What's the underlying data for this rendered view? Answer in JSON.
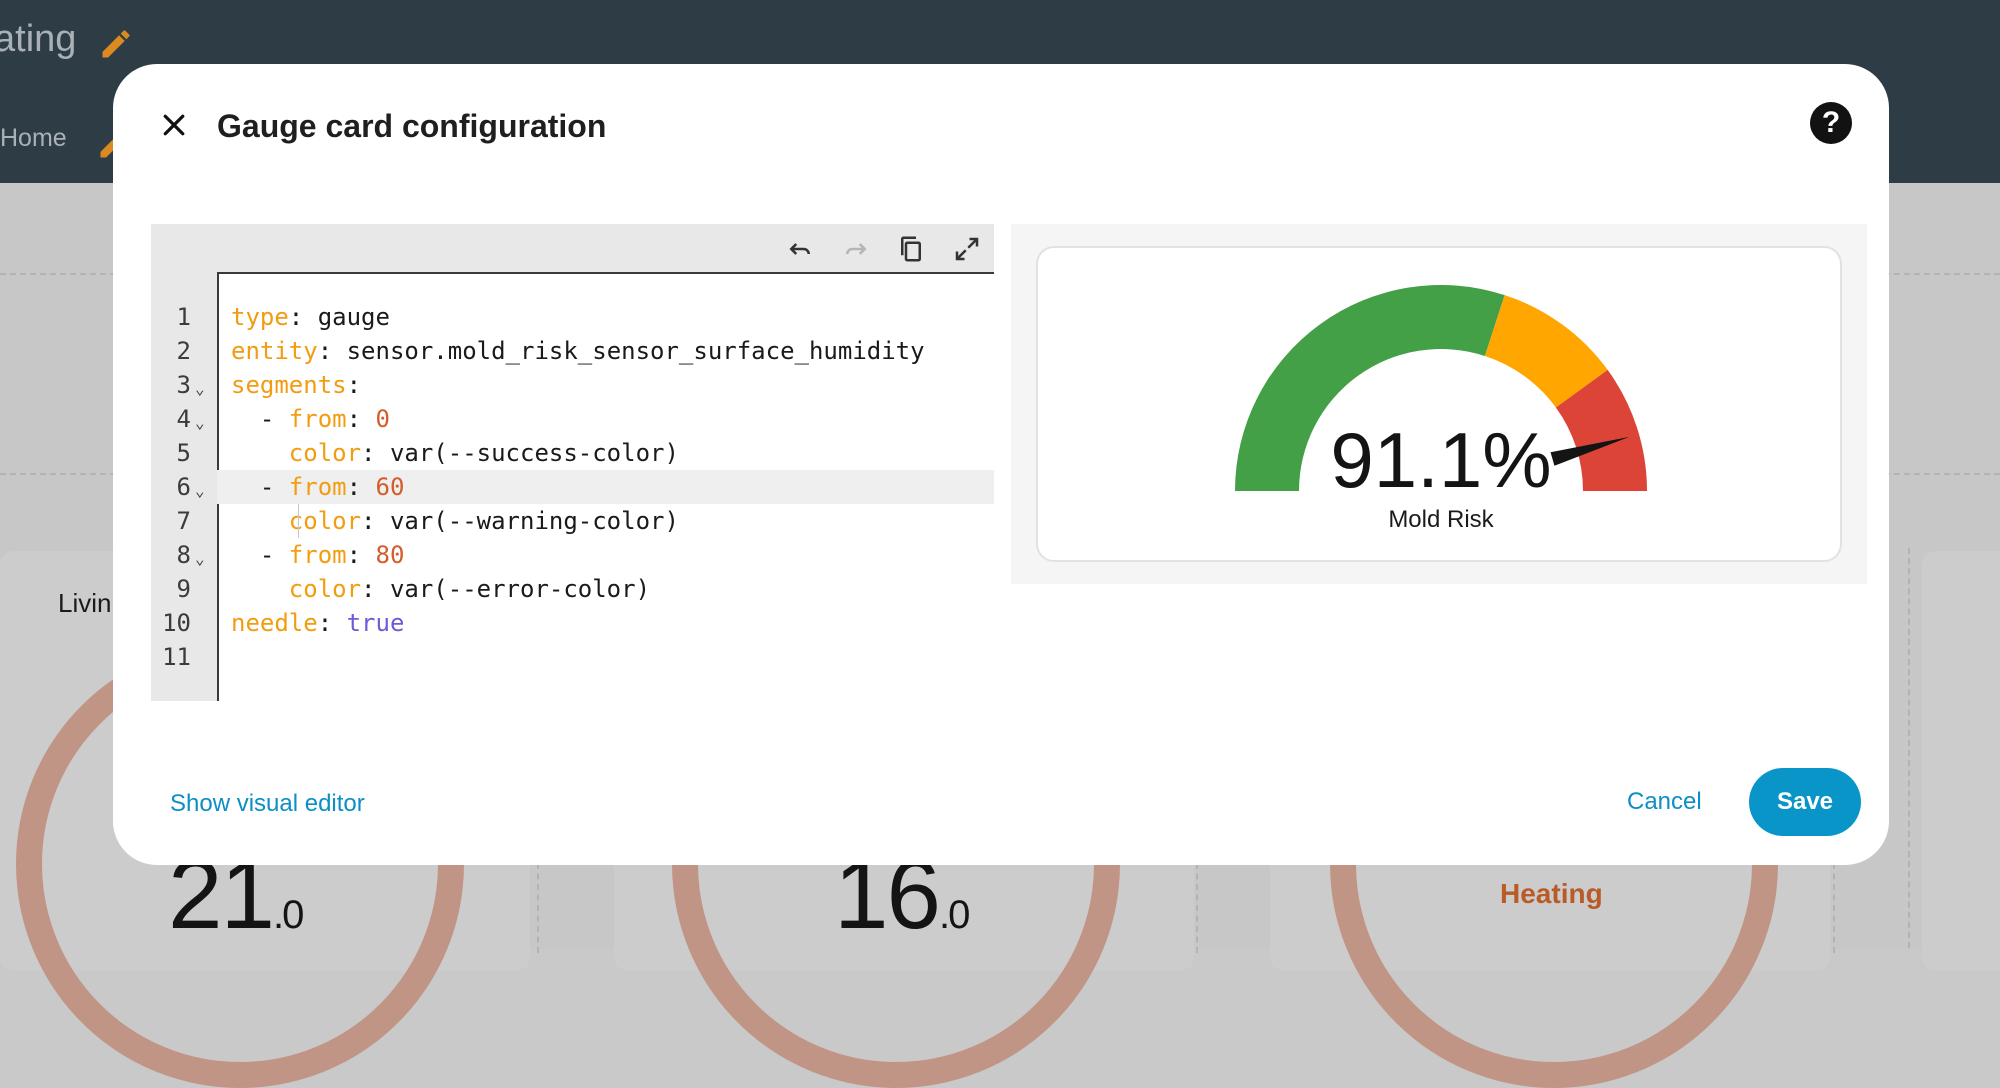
{
  "background": {
    "title": "ating",
    "tab_label": "Home",
    "living_label": "Livin",
    "temp1_main": "21",
    "temp1_dec": ".0",
    "temp2_main": "16",
    "temp2_dec": ".0",
    "heating_label": "Heating"
  },
  "dialog": {
    "title": "Gauge card configuration",
    "help_glyph": "?",
    "show_visual_editor": "Show visual editor",
    "cancel": "Cancel",
    "save": "Save"
  },
  "editor": {
    "toolbar": [
      "undo-icon",
      "redo-icon",
      "copy-icon",
      "fullscreen-icon"
    ],
    "lines": [
      {
        "n": "1",
        "fold": false,
        "code": [
          {
            "t": "type",
            "c": "k"
          },
          {
            "t": ": gauge",
            "c": ""
          }
        ]
      },
      {
        "n": "2",
        "fold": false,
        "code": [
          {
            "t": "entity",
            "c": "k"
          },
          {
            "t": ": sensor.mold_risk_sensor_surface_humidity",
            "c": ""
          }
        ]
      },
      {
        "n": "3",
        "fold": true,
        "code": [
          {
            "t": "segments",
            "c": "k"
          },
          {
            "t": ":",
            "c": ""
          }
        ]
      },
      {
        "n": "4",
        "fold": true,
        "code": [
          {
            "t": "  - ",
            "c": ""
          },
          {
            "t": "from",
            "c": "k"
          },
          {
            "t": ": ",
            "c": ""
          },
          {
            "t": "0",
            "c": "n"
          }
        ]
      },
      {
        "n": "5",
        "fold": false,
        "code": [
          {
            "t": "    ",
            "c": ""
          },
          {
            "t": "color",
            "c": "k"
          },
          {
            "t": ": var(--success-color)",
            "c": ""
          }
        ]
      },
      {
        "n": "6",
        "fold": true,
        "code": [
          {
            "t": "  - ",
            "c": ""
          },
          {
            "t": "from",
            "c": "k"
          },
          {
            "t": ": ",
            "c": ""
          },
          {
            "t": "60",
            "c": "n"
          }
        ]
      },
      {
        "n": "7",
        "fold": false,
        "code": [
          {
            "t": "    ",
            "c": ""
          },
          {
            "t": "color",
            "c": "k"
          },
          {
            "t": ": var(--warning-color)",
            "c": ""
          }
        ]
      },
      {
        "n": "8",
        "fold": true,
        "code": [
          {
            "t": "  - ",
            "c": ""
          },
          {
            "t": "from",
            "c": "k"
          },
          {
            "t": ": ",
            "c": ""
          },
          {
            "t": "80",
            "c": "n"
          }
        ]
      },
      {
        "n": "9",
        "fold": false,
        "code": [
          {
            "t": "    ",
            "c": ""
          },
          {
            "t": "color",
            "c": "k"
          },
          {
            "t": ": var(--error-color)",
            "c": ""
          }
        ]
      },
      {
        "n": "10",
        "fold": false,
        "code": [
          {
            "t": "needle",
            "c": "k"
          },
          {
            "t": ": ",
            "c": ""
          },
          {
            "t": "true",
            "c": "b"
          }
        ]
      },
      {
        "n": "11",
        "fold": false,
        "code": []
      }
    ],
    "active_line": "6"
  },
  "preview": {
    "value_text": "91.1%",
    "name": "Mold Risk",
    "gauge": {
      "min": 0,
      "max": 100,
      "value": 91.1,
      "segments": [
        {
          "from": 0,
          "color": "#43a047"
        },
        {
          "from": 60,
          "color": "#ffa600"
        },
        {
          "from": 80,
          "color": "#db4437"
        }
      ],
      "needle_color": "#141414"
    }
  },
  "colors": {
    "accent": "#0a95c9",
    "topbar": "#2e3c45",
    "pencil": "#d98b20"
  }
}
